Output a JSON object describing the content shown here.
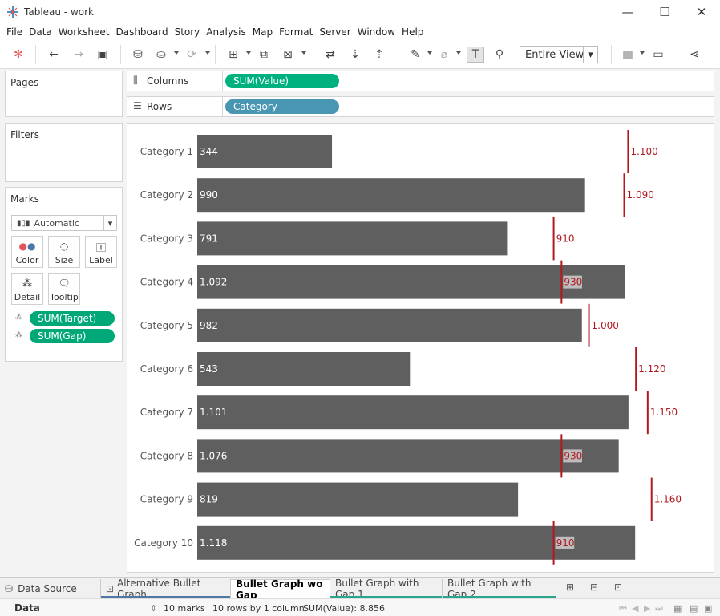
{
  "window": {
    "title": "Tableau - work",
    "controls": {
      "minimize": "—",
      "maximize": "☐",
      "close": "✕"
    }
  },
  "menu": [
    "File",
    "Data",
    "Worksheet",
    "Dashboard",
    "Story",
    "Analysis",
    "Map",
    "Format",
    "Server",
    "Window",
    "Help"
  ],
  "toolbar": {
    "fit_label": "Entire View"
  },
  "panels": {
    "pages": "Pages",
    "filters": "Filters",
    "marks": "Marks"
  },
  "marks": {
    "type": "Automatic",
    "cards": [
      "Color",
      "Size",
      "Label",
      "Detail",
      "Tooltip"
    ],
    "fields": [
      "SUM(Target)",
      "SUM(Gap)"
    ]
  },
  "shelves": {
    "columns": {
      "label": "Columns",
      "pill": "SUM(Value)",
      "color": "#00b180"
    },
    "rows": {
      "label": "Rows",
      "pill": "Category",
      "color": "#4996b2"
    }
  },
  "colors": {
    "bar": "#5f5f5f",
    "target": "#b2191f",
    "target_label": "#b2191f"
  },
  "chart_data": {
    "type": "bar",
    "orientation": "horizontal",
    "categories": [
      "Category 1",
      "Category 2",
      "Category 3",
      "Category 4",
      "Category 5",
      "Category 6",
      "Category 7",
      "Category 8",
      "Category 9",
      "Category 10"
    ],
    "series": [
      {
        "name": "SUM(Value)",
        "values": [
          344,
          990,
          791,
          1092,
          982,
          543,
          1101,
          1076,
          819,
          1118
        ]
      },
      {
        "name": "SUM(Target)",
        "values": [
          1100,
          1090,
          910,
          930,
          1000,
          1120,
          1150,
          930,
          1160,
          910
        ]
      }
    ],
    "value_labels": [
      "344",
      "990",
      "791",
      "1.092",
      "982",
      "543",
      "1.101",
      "1.076",
      "819",
      "1.118"
    ],
    "target_labels": [
      "1.100",
      "1.090",
      "910",
      "930",
      "1.000",
      "1.120",
      "1.150",
      "930",
      "1.160",
      "910"
    ],
    "xlim": [
      0,
      1310
    ],
    "grid": false
  },
  "tabs": {
    "data_source": "Data Source",
    "sheets": [
      {
        "label": "Alternative Bullet Graph",
        "active": false,
        "color": "#4e79a7"
      },
      {
        "label": "Bullet Graph wo Gap",
        "active": true,
        "color": ""
      },
      {
        "label": "Bullet Graph with Gap 1",
        "active": false,
        "color": "#2ca58d"
      },
      {
        "label": "Bullet Graph with Gap 2",
        "active": false,
        "color": "#2ca58d"
      }
    ]
  },
  "status": {
    "pane": "Data",
    "marks": "10 marks",
    "dims": "10 rows by 1 column",
    "sum": "SUM(Value): 8.856"
  }
}
